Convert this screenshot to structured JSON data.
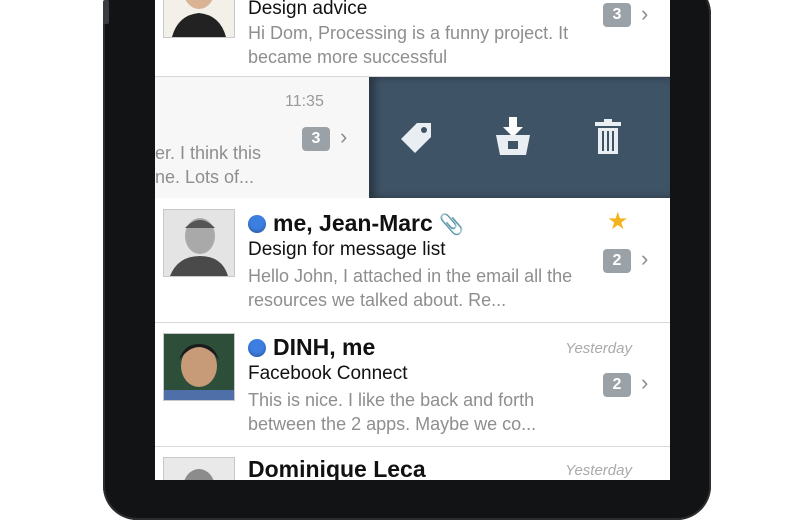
{
  "messages": [
    {
      "subject": "Design advice",
      "preview": "Hi Dom, Processing is a funny project. It became more successful",
      "count": "3"
    },
    {
      "time": "11:35",
      "count": "3",
      "preview": "er. I think this ne. Lots of..."
    },
    {
      "sender": "me, Jean-Marc",
      "subject": "Design for message list",
      "preview": "Hello John, I attached in the email all the resources we talked about. Re...",
      "count": "2"
    },
    {
      "sender": "DINH, me",
      "date": "Yesterday",
      "subject": "Facebook Connect",
      "preview": "This is nice. I like the back and forth between the 2 apps. Maybe we co...",
      "count": "2"
    },
    {
      "sender": "Dominique Leca",
      "date": "Yesterday"
    }
  ],
  "swipe_actions": [
    "tag-icon",
    "archive-icon",
    "trash-icon"
  ],
  "colors": {
    "action_tray": "#3f5366",
    "unread_dot": "#3d7fe1",
    "star": "#f2b51f",
    "count_badge": "#9aa1a7"
  }
}
